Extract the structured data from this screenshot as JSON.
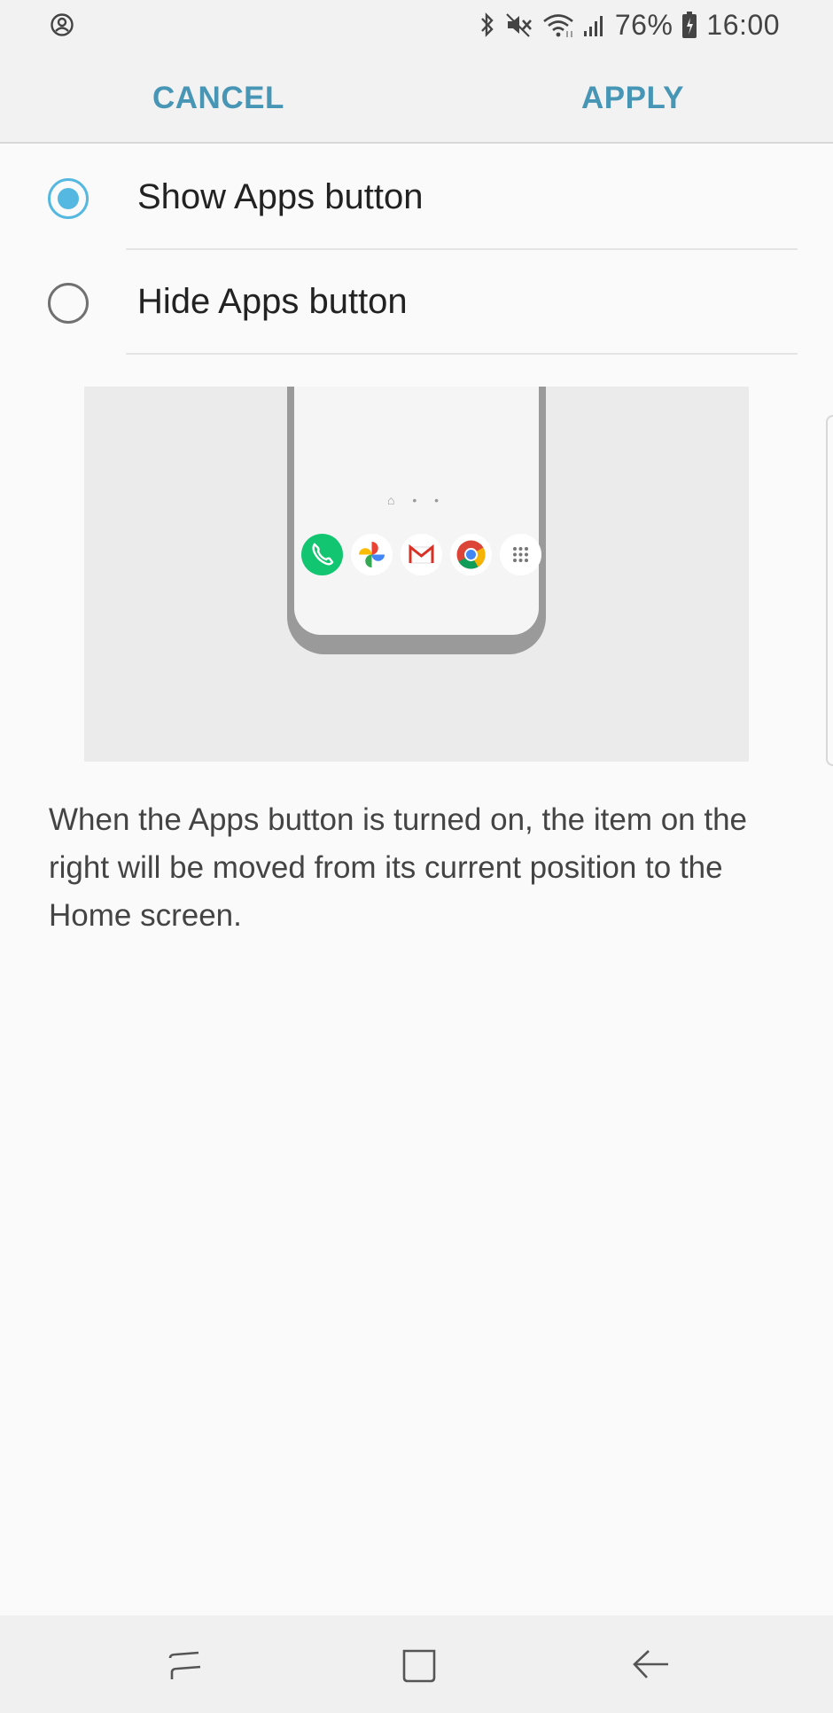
{
  "status_bar": {
    "left_icon": "account-circle-icon",
    "icons": [
      "bluetooth-icon",
      "mute-icon",
      "wifi-icon",
      "signal-icon",
      "battery-icon"
    ],
    "battery_percent": "76%",
    "time": "16:00"
  },
  "header": {
    "cancel_label": "CANCEL",
    "apply_label": "APPLY",
    "accent_color": "#4896b6"
  },
  "options": [
    {
      "label": "Show Apps button",
      "selected": true
    },
    {
      "label": "Hide Apps button",
      "selected": false
    }
  ],
  "preview": {
    "dock_apps": [
      "phone-icon",
      "photos-icon",
      "gmail-icon",
      "chrome-icon",
      "apps-grid-icon"
    ],
    "page_indicator": "⌂ • •"
  },
  "description": "When the Apps button is turned on, the item on the right will be moved from its current position to the Home screen.",
  "nav_bar": {
    "buttons": [
      "recent-apps-icon",
      "home-icon",
      "back-icon"
    ]
  }
}
